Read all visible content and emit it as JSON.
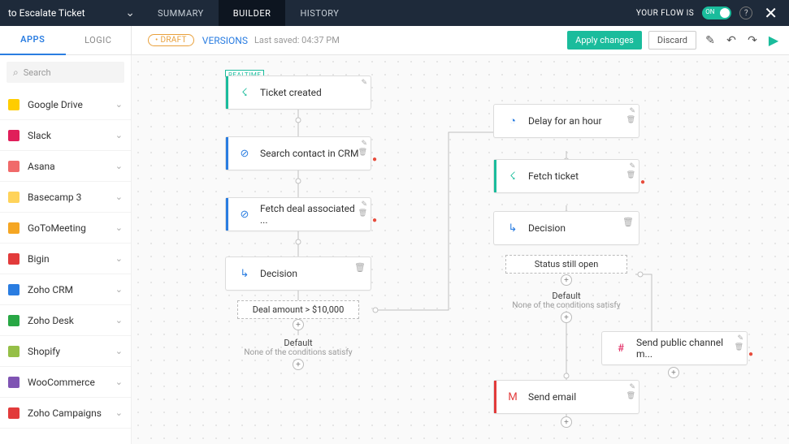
{
  "header": {
    "flow_title": "to Escalate Ticket",
    "tabs": [
      "SUMMARY",
      "BUILDER",
      "HISTORY"
    ],
    "flow_status_label": "YOUR FLOW IS",
    "toggle_on": "ON"
  },
  "secondbar": {
    "subtabs": [
      "APPS",
      "LOGIC"
    ],
    "draft": "• DRAFT",
    "versions": "VERSIONS",
    "last_saved": "Last saved: 04:37 PM",
    "apply": "Apply changes",
    "discard": "Discard"
  },
  "sidebar": {
    "search_placeholder": "Search",
    "apps": [
      {
        "name": "Google Drive",
        "color": "#ffcd00"
      },
      {
        "name": "Slack",
        "color": "#e01e5a"
      },
      {
        "name": "Asana",
        "color": "#f06a6a"
      },
      {
        "name": "Basecamp 3",
        "color": "#ffd35a"
      },
      {
        "name": "GoToMeeting",
        "color": "#f5a623"
      },
      {
        "name": "Bigin",
        "color": "#e23b3b"
      },
      {
        "name": "Zoho CRM",
        "color": "#2a7de1"
      },
      {
        "name": "Zoho Desk",
        "color": "#28a745"
      },
      {
        "name": "Shopify",
        "color": "#95bf47"
      },
      {
        "name": "WooCommerce",
        "color": "#7f54b3"
      },
      {
        "name": "Zoho Campaigns",
        "color": "#e23b3b"
      }
    ]
  },
  "canvas": {
    "realtime_badge": "REALTIME",
    "nodes": {
      "ticket_created": {
        "label": "Ticket created",
        "barColor": "#1abc9c"
      },
      "search_contact": {
        "label": "Search contact in CRM",
        "barColor": "#2a7de1"
      },
      "fetch_deal": {
        "label": "Fetch deal associated ...",
        "barColor": "#2a7de1"
      },
      "decision1": {
        "label": "Decision",
        "barColor": "#fff"
      },
      "cond_deal": "Deal amount > $10,000",
      "default1": {
        "title": "Default",
        "sub": "None of the conditions satisfy"
      },
      "delay": {
        "label": "Delay for an hour",
        "barColor": "#fff"
      },
      "fetch_ticket": {
        "label": "Fetch ticket",
        "barColor": "#1abc9c"
      },
      "decision2": {
        "label": "Decision",
        "barColor": "#fff"
      },
      "cond_status": "Status still open",
      "default2": {
        "title": "Default",
        "sub": "None of the conditions satisfy"
      },
      "slack_msg": {
        "label": "Send public channel m..."
      },
      "send_email": {
        "label": "Send email",
        "barColor": "#e23b3b"
      }
    }
  }
}
